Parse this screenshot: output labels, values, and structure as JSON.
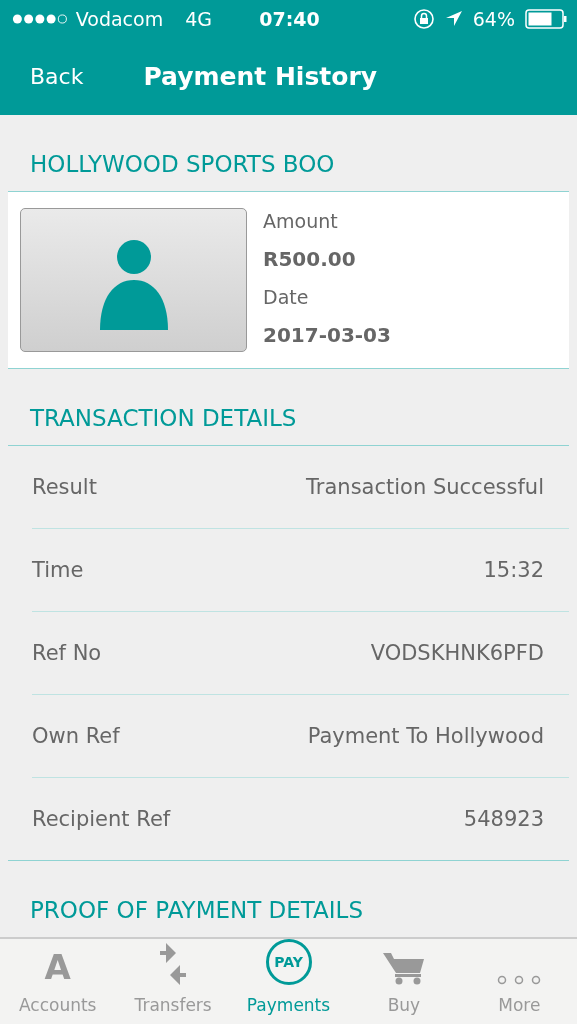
{
  "status_bar": {
    "carrier": "Vodacom",
    "network": "4G",
    "time": "07:40",
    "battery": "64%"
  },
  "nav": {
    "back": "Back",
    "title": "Payment History"
  },
  "recipient": {
    "heading": "HOLLYWOOD SPORTS BOO",
    "amount_label": "Amount",
    "amount": "R500.00",
    "date_label": "Date",
    "date": "2017-03-03"
  },
  "transaction": {
    "heading": "TRANSACTION DETAILS",
    "rows": [
      {
        "label": "Result",
        "value": "Transaction Successful"
      },
      {
        "label": "Time",
        "value": "15:32"
      },
      {
        "label": "Ref No",
        "value": "VODSKHNK6PFD"
      },
      {
        "label": "Own Ref",
        "value": "Payment To Hollywood"
      },
      {
        "label": "Recipient Ref",
        "value": "548923"
      }
    ]
  },
  "proof": {
    "heading": "PROOF OF PAYMENT DETAILS"
  },
  "tabs": [
    {
      "kind": "accounts",
      "label": "Accounts",
      "glyph": "A",
      "selected": false
    },
    {
      "kind": "transfers",
      "label": "Transfers",
      "selected": false
    },
    {
      "kind": "pay",
      "label": "Payments",
      "glyph": "PAY",
      "selected": true
    },
    {
      "kind": "buy",
      "label": "Buy",
      "selected": false
    },
    {
      "kind": "more",
      "label": "More",
      "selected": false
    }
  ]
}
